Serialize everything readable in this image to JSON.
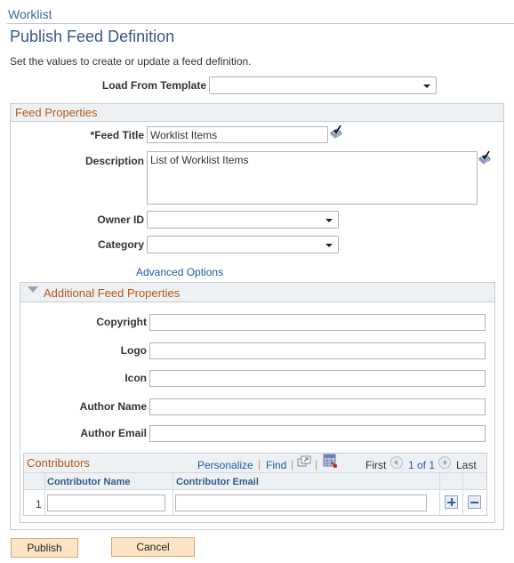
{
  "breadcrumb": "Worklist",
  "page_title": "Publish Feed Definition",
  "instructions": "Set the values to create or update a feed definition.",
  "load_template": {
    "label": "Load From Template",
    "value": ""
  },
  "feed_properties": {
    "header": "Feed Properties",
    "feed_title": {
      "label": "*Feed Title",
      "value": "Worklist Items"
    },
    "description": {
      "label": "Description",
      "value": "List of Worklist Items"
    },
    "owner_id": {
      "label": "Owner ID",
      "value": ""
    },
    "category": {
      "label": "Category",
      "value": ""
    },
    "advanced_options_link": "Advanced Options"
  },
  "additional": {
    "header": "Additional Feed Properties",
    "fields": [
      {
        "label": "Copyright",
        "value": ""
      },
      {
        "label": "Logo",
        "value": ""
      },
      {
        "label": "Icon",
        "value": ""
      },
      {
        "label": "Author Name",
        "value": ""
      },
      {
        "label": "Author Email",
        "value": ""
      }
    ]
  },
  "contributors": {
    "title": "Contributors",
    "personalize": "Personalize",
    "find": "Find",
    "sep": "|",
    "first": "First",
    "range": "1 of 1",
    "last": "Last",
    "columns": [
      "Contributor Name",
      "Contributor Email"
    ],
    "rows": [
      {
        "num": "1",
        "name": "",
        "email": ""
      }
    ]
  },
  "buttons": {
    "publish": "Publish",
    "cancel": "Cancel"
  }
}
